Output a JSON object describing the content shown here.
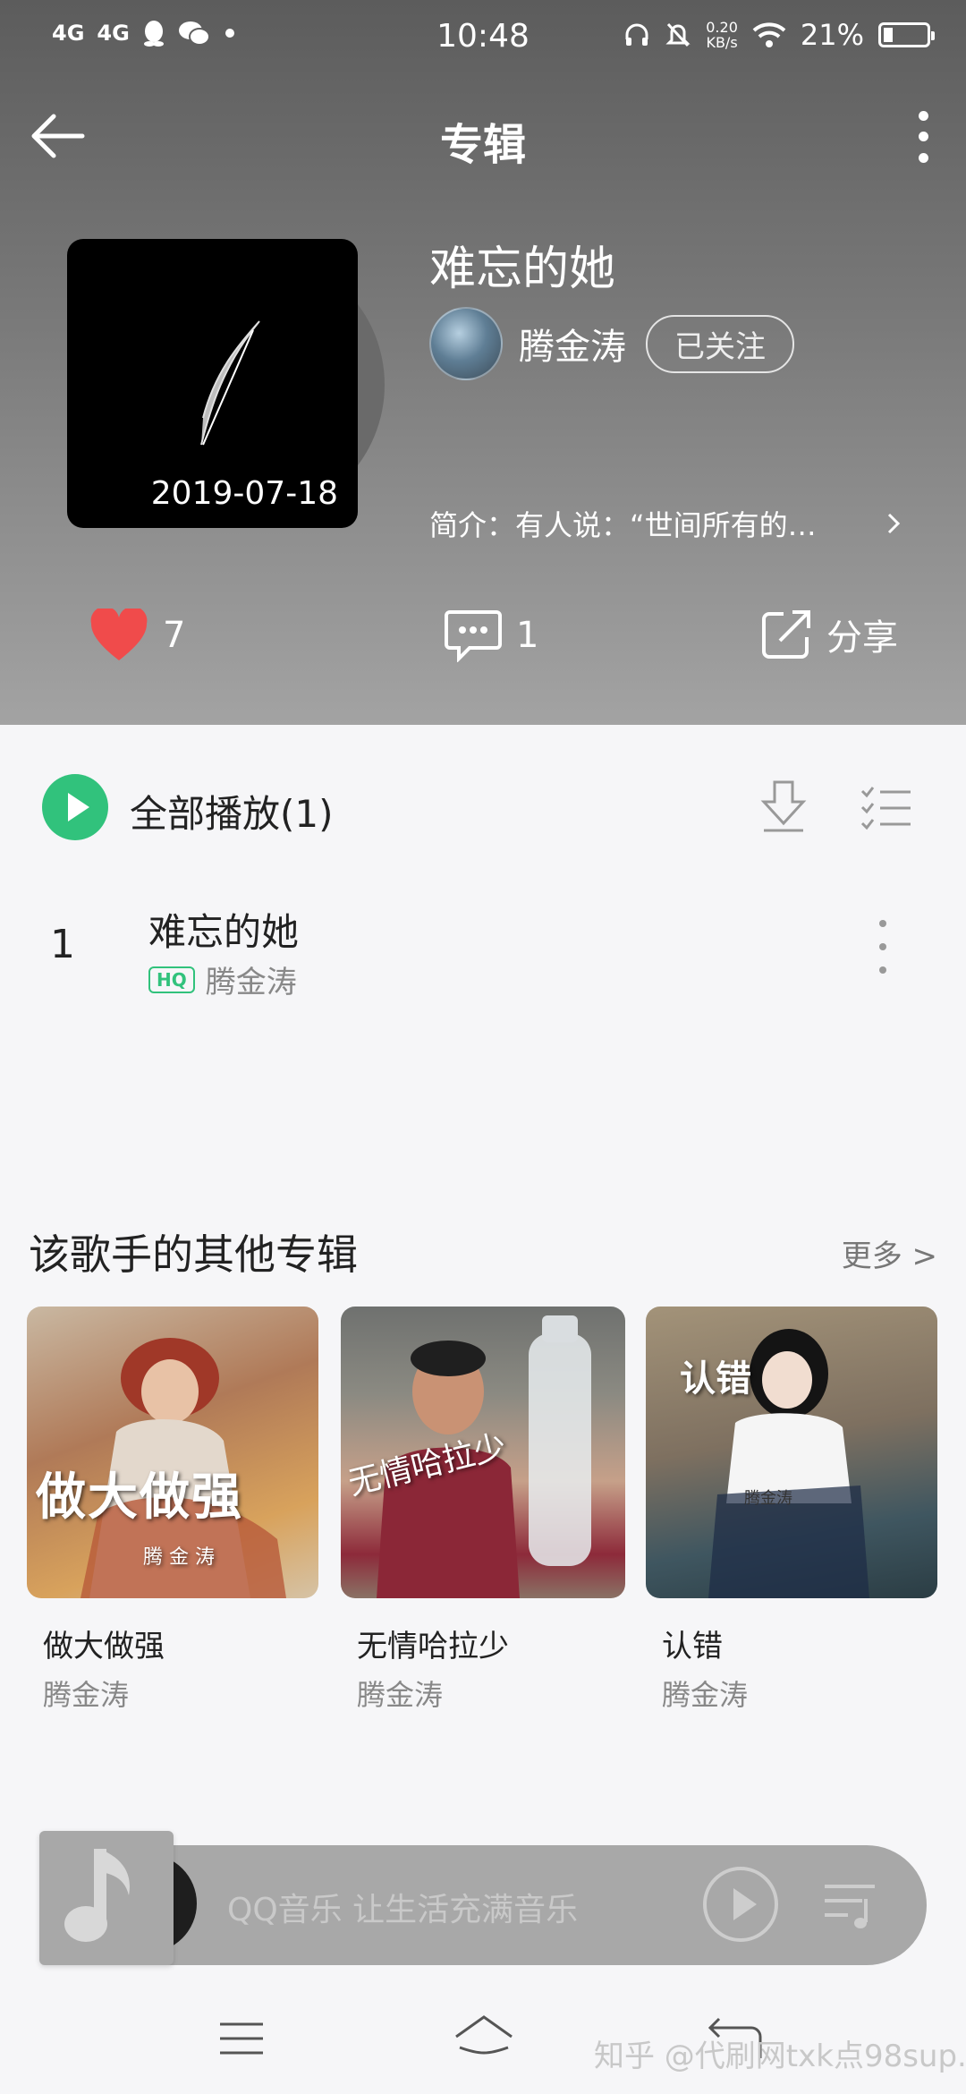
{
  "status_bar": {
    "network_1": "4G",
    "network_2": "4G",
    "time": "10:48",
    "speed_value": "0.20",
    "speed_unit": "KB/s",
    "battery": "21%"
  },
  "nav": {
    "title": "专辑"
  },
  "album": {
    "cover_date": "2019-07-18",
    "title": "难忘的她",
    "artist": "腾金涛",
    "follow_label": "已关注",
    "intro": "简介：有人说：“世间所有的…"
  },
  "actions": {
    "like_count": "7",
    "comment_count": "1",
    "share_label": "分享"
  },
  "playlist": {
    "play_all_label": "全部播放(1)",
    "songs": [
      {
        "index": "1",
        "title": "难忘的她",
        "badge": "HQ",
        "artist": "腾金涛"
      }
    ]
  },
  "other_albums": {
    "section_title": "该歌手的其他专辑",
    "more_label": "更多 >",
    "items": [
      {
        "name": "做大做强",
        "artist": "腾金涛",
        "cover_text": "做大做强",
        "cover_sub": "腾 金 涛"
      },
      {
        "name": "无情哈拉少",
        "artist": "腾金涛",
        "cover_text": "无情哈拉少"
      },
      {
        "name": "认错",
        "artist": "腾金涛",
        "cover_text": "认错",
        "cover_sub": "腾金涛"
      }
    ]
  },
  "mini_player": {
    "text": "QQ音乐 让生活充满音乐"
  },
  "watermark": "知乎 @代刷网txk点98sup...",
  "colors": {
    "accent_green": "#31c27c",
    "like_red": "#f04b4b"
  }
}
